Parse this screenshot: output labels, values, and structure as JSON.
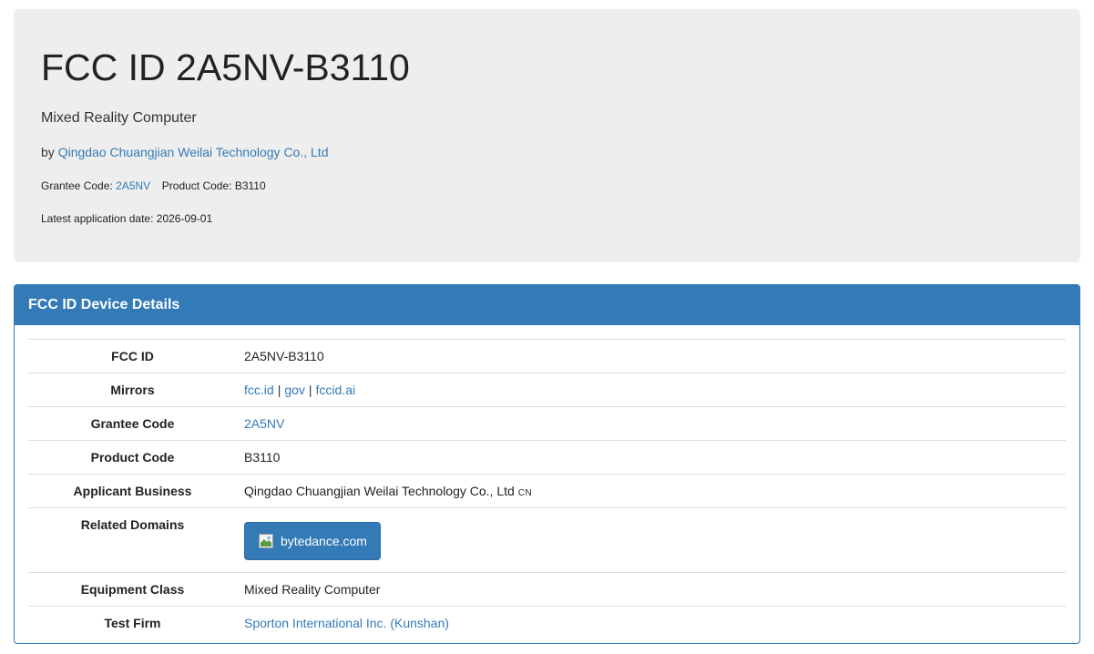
{
  "header": {
    "title": "FCC ID 2A5NV-B3110",
    "subtitle": "Mixed Reality Computer",
    "by_prefix": "by",
    "company": "Qingdao Chuangjian Weilai Technology Co., Ltd",
    "grantee_label": "Grantee Code:",
    "grantee_code": "2A5NV",
    "product_label": "Product Code:",
    "product_code": "B3110",
    "latest_label": "Latest application date:",
    "latest_date": "2026-09-01"
  },
  "panel": {
    "heading": "FCC ID Device Details",
    "rows": {
      "fcc_id": {
        "key": "FCC ID",
        "value": "2A5NV-B3110"
      },
      "mirrors": {
        "key": "Mirrors",
        "links": [
          "fcc.id",
          "gov",
          "fccid.ai"
        ],
        "separator": "|"
      },
      "grantee_code": {
        "key": "Grantee Code",
        "value": "2A5NV"
      },
      "product_code": {
        "key": "Product Code",
        "value": "B3110"
      },
      "applicant_business": {
        "key": "Applicant Business",
        "value": "Qingdao Chuangjian Weilai Technology Co., Ltd",
        "country": "CN"
      },
      "related_domains": {
        "key": "Related Domains",
        "button_label": "bytedance.com",
        "icon": "broken-image-icon"
      },
      "equipment_class": {
        "key": "Equipment Class",
        "value": "Mixed Reality Computer"
      },
      "test_firm": {
        "key": "Test Firm",
        "value": "Sporton International Inc. (Kunshan)"
      }
    }
  },
  "colors": {
    "accent": "#337ab7",
    "jumbotron_bg": "#eeeeee",
    "border": "#dddddd"
  }
}
